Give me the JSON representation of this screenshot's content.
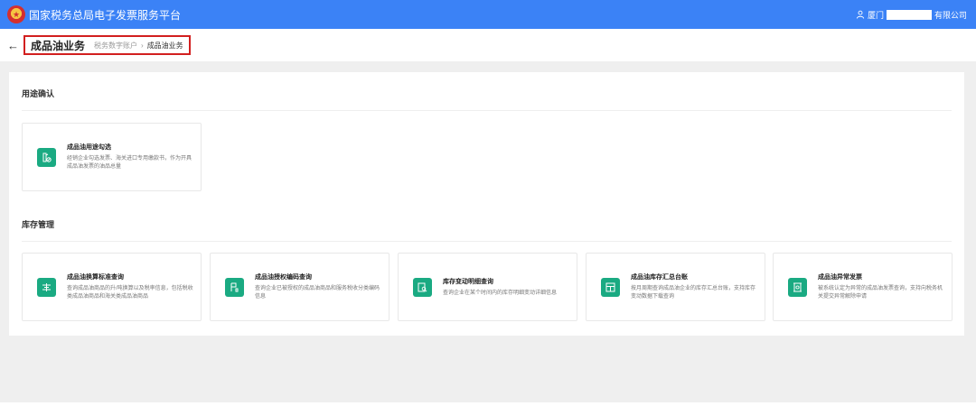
{
  "header": {
    "title": "国家税务总局电子发票服务平台",
    "user_prefix": "厦门",
    "user_suffix": "有限公司"
  },
  "subheader": {
    "page_title": "成品油业务",
    "breadcrumb": [
      "税务数字账户",
      "成品油业务"
    ]
  },
  "sections": {
    "usage": {
      "title": "用途确认",
      "cards": [
        {
          "title": "成品油用途勾选",
          "desc": "经销企业勾选发票、海关进口专用缴款书，作为开具成品油发票的油品总量",
          "icon": "oil-check-icon"
        }
      ]
    },
    "inventory": {
      "title": "库存管理",
      "cards": [
        {
          "title": "成品油换算标准查询",
          "desc": "查询成品油商品的升/吨换算以及税率信息，包括税收类成品油商品和海关类成品油商品",
          "icon": "conversion-icon"
        },
        {
          "title": "成品油授权编码查询",
          "desc": "查询企业已被授权的成品油商品和服务税收分类编码信息",
          "icon": "auth-code-icon"
        },
        {
          "title": "库存变动明细查询",
          "desc": "查询企业在某个时间内的库存明细变动详细信息",
          "icon": "inventory-search-icon"
        },
        {
          "title": "成品油库存汇总台账",
          "desc": "按月周期查询成品油企业的库存汇总台账，支持库存变动数据下载查询",
          "icon": "ledger-icon"
        },
        {
          "title": "成品油异常发票",
          "desc": "被系统认定为异常的成品油发票查询，支持向税务机关提交异常解除申请",
          "icon": "abnormal-invoice-icon"
        }
      ]
    }
  },
  "colors": {
    "topbar": "#3b82f6",
    "accent": "#1aaa82",
    "highlight": "#d21f1f"
  }
}
